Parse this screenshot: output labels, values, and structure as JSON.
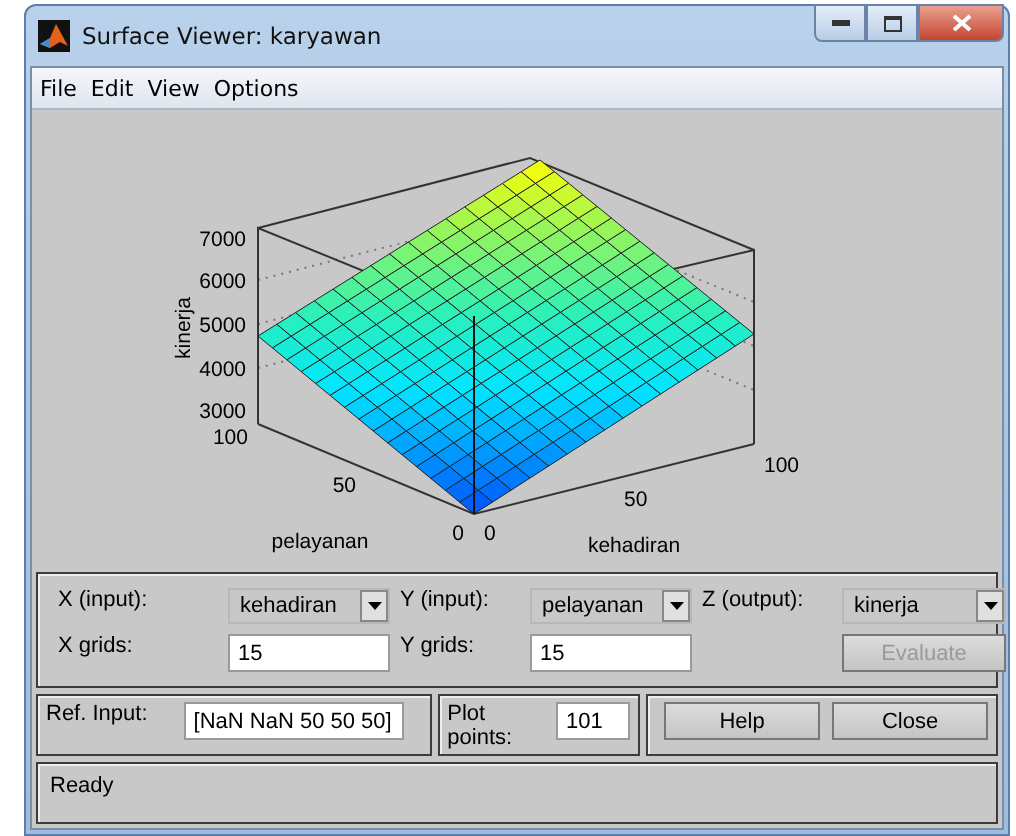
{
  "window": {
    "title": "Surface Viewer: karyawan"
  },
  "menu": [
    {
      "label": "File"
    },
    {
      "label": "Edit"
    },
    {
      "label": "View"
    },
    {
      "label": "Options"
    }
  ],
  "plot": {
    "z_label": "kinerja",
    "z_ticks": [
      "7000",
      "6000",
      "5000",
      "4000",
      "3000"
    ],
    "y_label": "pelayanan",
    "y_ticks": [
      "100",
      "50",
      "0"
    ],
    "x_label": "kehadiran",
    "x_ticks": [
      "0",
      "50",
      "100"
    ]
  },
  "controls": {
    "x_input": {
      "label": "X (input):",
      "value": "kehadiran"
    },
    "y_input": {
      "label": "Y (input):",
      "value": "pelayanan"
    },
    "z_output": {
      "label": "Z (output):",
      "value": "kinerja"
    },
    "x_grids": {
      "label": "X grids:",
      "value": "15"
    },
    "y_grids": {
      "label": "Y grids:",
      "value": "15"
    },
    "evaluate": {
      "label": "Evaluate",
      "disabled": true
    }
  },
  "ref_input": {
    "label": "Ref. Input:",
    "value": "[NaN NaN 50 50 50]"
  },
  "plot_points": {
    "label": "Plot points:",
    "value": "101"
  },
  "buttons": [
    "Help",
    "Close"
  ],
  "status": "Ready"
}
